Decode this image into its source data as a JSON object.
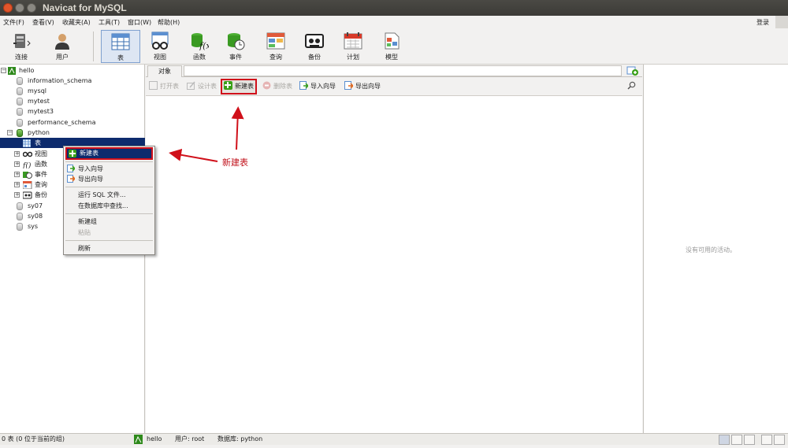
{
  "window": {
    "title": "Navicat for MySQL"
  },
  "menu": {
    "items": [
      "文件(F)",
      "查看(V)",
      "收藏夹(A)",
      "工具(T)",
      "窗口(W)",
      "帮助(H)"
    ],
    "login": "登录"
  },
  "toolbar": {
    "items": [
      {
        "label": "连接",
        "icon": "connection-icon"
      },
      {
        "label": "用户",
        "icon": "user-icon"
      },
      {
        "label": "表",
        "icon": "table-icon",
        "active": true
      },
      {
        "label": "视图",
        "icon": "view-icon"
      },
      {
        "label": "函数",
        "icon": "function-icon"
      },
      {
        "label": "事件",
        "icon": "event-icon"
      },
      {
        "label": "查询",
        "icon": "query-icon"
      },
      {
        "label": "备份",
        "icon": "backup-icon"
      },
      {
        "label": "计划",
        "icon": "schedule-icon"
      },
      {
        "label": "模型",
        "icon": "model-icon"
      }
    ]
  },
  "tree": {
    "connection": "hello",
    "databases": [
      "information_schema",
      "mysql",
      "mytest",
      "mytest3",
      "performance_schema"
    ],
    "open_db": "python",
    "open_db_children": [
      "表",
      "视图",
      "函数",
      "事件",
      "查询",
      "备份"
    ],
    "more_databases": [
      "sy07",
      "sy08",
      "sys"
    ]
  },
  "context_menu": {
    "items": [
      "新建表",
      "导入向导",
      "导出向导",
      "运行 SQL 文件...",
      "在数据库中查找...",
      "新建组",
      "粘贴",
      "刷新"
    ]
  },
  "main": {
    "tab": "对象",
    "object_toolbar": [
      "打开表",
      "设计表",
      "新建表",
      "删除表",
      "导入向导",
      "导出向导"
    ]
  },
  "annotation": {
    "text": "新建表"
  },
  "right_panel": {
    "empty_text": "没有可用的活动。"
  },
  "status": {
    "left": "0 表 (0 位于当前的组)",
    "connection": "hello",
    "user": "用户: root",
    "database": "数据库: python"
  },
  "colors": {
    "selection": "#0d2b6d",
    "annotation_red": "#d0101a",
    "accent_green": "#3aa018"
  }
}
